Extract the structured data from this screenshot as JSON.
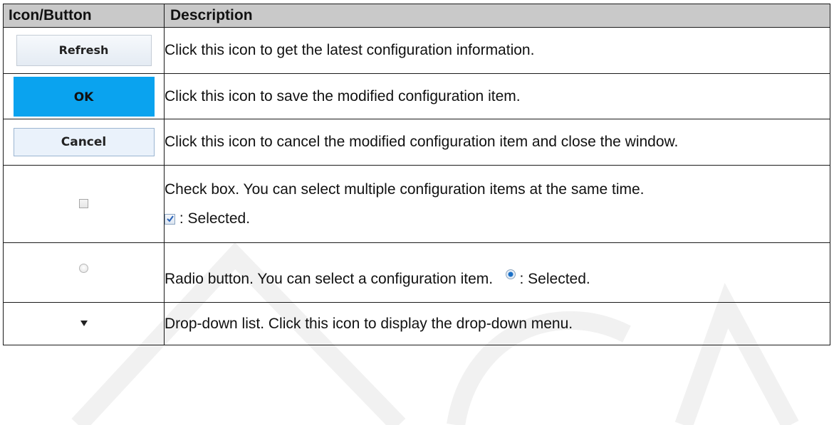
{
  "header": {
    "col1": "Icon/Button",
    "col2": "Description"
  },
  "rows": [
    {
      "icon": "refresh-button",
      "label": "Refresh",
      "description": "Click this icon to get the latest configuration information."
    },
    {
      "icon": "ok-button",
      "label": "OK",
      "description": "Click this icon to save the modified configuration item."
    },
    {
      "icon": "cancel-button",
      "label": "Cancel",
      "description": "Click this icon to cancel the modified configuration item and close the window."
    },
    {
      "icon": "checkbox-icon",
      "description_line1": "Check box. You can select multiple configuration items at the same time.",
      "description_line2": ": Selected."
    },
    {
      "icon": "radio-icon",
      "description_main": "Radio button. You can select a configuration item.",
      "description_selected": ": Selected."
    },
    {
      "icon": "dropdown-arrow-icon",
      "description": "Drop-down list. Click this icon to display the drop-down menu."
    }
  ],
  "colors": {
    "header_bg": "#c9c9c9",
    "ok_button": "#0aa3ef",
    "border": "#1a1a1a"
  }
}
